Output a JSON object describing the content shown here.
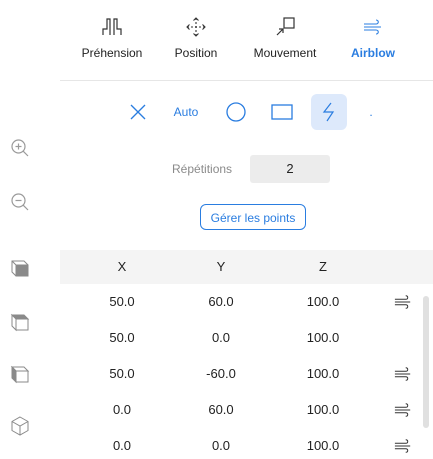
{
  "sidebar": {
    "items": [
      {
        "name": "zoom-in",
        "icon": "zoom-in-icon"
      },
      {
        "name": "zoom-out",
        "icon": "zoom-out-icon"
      },
      {
        "name": "view-front",
        "icon": "cube-front-icon"
      },
      {
        "name": "view-top",
        "icon": "cube-top-icon"
      },
      {
        "name": "view-side",
        "icon": "cube-side-icon"
      },
      {
        "name": "view-iso",
        "icon": "cube-iso-icon"
      }
    ]
  },
  "tabs": [
    {
      "label": "Préhension",
      "icon": "gripper-icon",
      "active": false
    },
    {
      "label": "Position",
      "icon": "move-arrows-icon",
      "active": false
    },
    {
      "label": "Mouvement",
      "icon": "movement-icon",
      "active": false
    },
    {
      "label": "Airblow",
      "icon": "airblow-icon",
      "active": true
    }
  ],
  "modes": {
    "auto_label": "Auto",
    "dot_label": ".",
    "selected": "lightning",
    "items": [
      "close-icon",
      "auto",
      "circle-icon",
      "rectangle-icon",
      "lightning-icon",
      "dot"
    ]
  },
  "repetitions": {
    "label": "Répétitions",
    "value": "2"
  },
  "manage_button": {
    "label": "Gérer les points"
  },
  "table": {
    "headers": [
      "X",
      "Y",
      "Z"
    ],
    "rows": [
      {
        "x": "50.0",
        "y": "60.0",
        "z": "100.0",
        "airblow": true
      },
      {
        "x": "50.0",
        "y": "0.0",
        "z": "100.0",
        "airblow": false
      },
      {
        "x": "50.0",
        "y": "-60.0",
        "z": "100.0",
        "airblow": true
      },
      {
        "x": "0.0",
        "y": "60.0",
        "z": "100.0",
        "airblow": true
      },
      {
        "x": "0.0",
        "y": "0.0",
        "z": "100.0",
        "airblow": true
      }
    ]
  },
  "colors": {
    "accent": "#2a7de0",
    "selected_bg": "#dde9fb",
    "header_bg": "#f4f4f4",
    "value_bg": "#ececec",
    "muted_text": "#8a8a8a"
  }
}
